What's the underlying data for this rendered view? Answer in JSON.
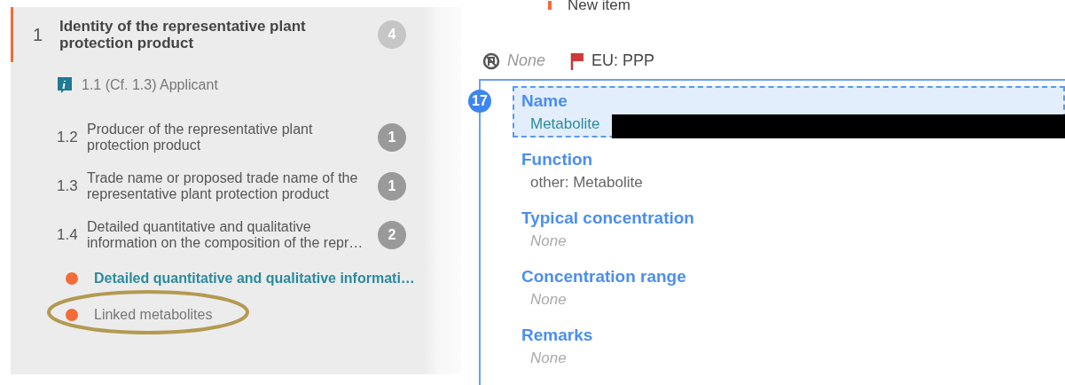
{
  "sidebar": {
    "items": [
      {
        "kind": "section",
        "number": "1",
        "title": "Identity of the representative plant protection product",
        "count": "4",
        "selected": true
      },
      {
        "kind": "info",
        "title": "1.1 (Cf. 1.3) Applicant"
      },
      {
        "kind": "subsection",
        "number": "1.2",
        "title": "Producer of the representative plant protection product",
        "count": "1"
      },
      {
        "kind": "subsection",
        "number": "1.3",
        "title": "Trade name or proposed trade name of the representative plant protection product",
        "count": "1"
      },
      {
        "kind": "subsection",
        "number": "1.4",
        "title": "Detailed quantitative and qualitative information on the composition of the repr…",
        "count": "2"
      },
      {
        "kind": "leaf",
        "title": "Detailed quantitative and qualitative informati…",
        "selected": true,
        "color": "#f26b38"
      },
      {
        "kind": "leaf",
        "title": "Linked metabolites",
        "selected": false,
        "color": "#f26b38",
        "annotated": true
      }
    ]
  },
  "header": {
    "new_item": "New item"
  },
  "toolbar": {
    "status": "None",
    "flag": "EU: PPP"
  },
  "record": {
    "index": "17",
    "fields": [
      {
        "label": "Name",
        "value": "Metabolite",
        "selected": true,
        "empty": false,
        "redacted": true
      },
      {
        "label": "Function",
        "value": "other: Metabolite",
        "selected": false,
        "empty": false
      },
      {
        "label": "Typical concentration",
        "value": "None",
        "selected": false,
        "empty": true
      },
      {
        "label": "Concentration range",
        "value": "None",
        "selected": false,
        "empty": true
      },
      {
        "label": "Remarks",
        "value": "None",
        "selected": false,
        "empty": true
      }
    ]
  }
}
